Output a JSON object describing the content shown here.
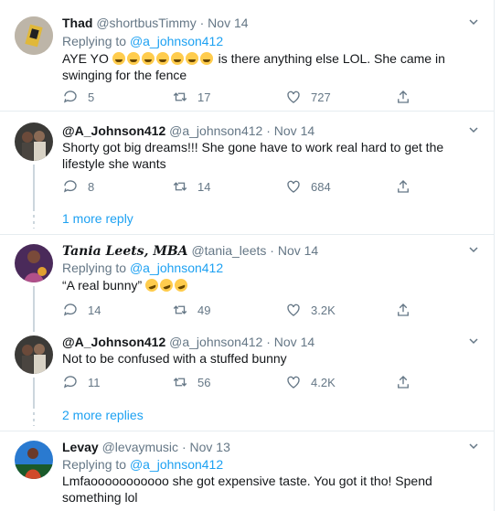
{
  "tweets": [
    {
      "name": "Thad",
      "handle": "@shortbusTimmy",
      "date": "Nov 14",
      "replying_label": "Replying to",
      "replying_to": "@a_johnson412",
      "text_before": "AYE YO",
      "emoji_count": 7,
      "text_after": "is there anything else LOL. She came in swinging for the fence",
      "replies": "5",
      "retweets": "17",
      "likes": "727"
    },
    {
      "name": "@A_Johnson412",
      "handle": "@a_johnson412",
      "date": "Nov 14",
      "text": "Shorty got big dreams!!! She gone have to work real hard to get the lifestyle she wants",
      "replies": "8",
      "retweets": "14",
      "likes": "684"
    },
    {
      "name": "Tania Leets, MBA",
      "handle": "@tania_leets",
      "date": "Nov 14",
      "replying_label": "Replying to",
      "replying_to": "@a_johnson412",
      "text": "“A real bunny”",
      "emoji_count": 3,
      "replies": "14",
      "retweets": "49",
      "likes": "3.2K"
    },
    {
      "name": "@A_Johnson412",
      "handle": "@a_johnson412",
      "date": "Nov 14",
      "text": "Not to be confused with a stuffed bunny",
      "replies": "11",
      "retweets": "56",
      "likes": "4.2K"
    },
    {
      "name": "Levay",
      "handle": "@levaymusic",
      "date": "Nov 13",
      "replying_label": "Replying to",
      "replying_to": "@a_johnson412",
      "text": "Lmfaooooooooooo she got expensive taste. You got it tho! Spend something lol"
    }
  ],
  "more_replies_1": "1 more reply",
  "more_replies_2": "2 more replies",
  "separator": "·",
  "colors": {
    "accent": "#1da1f2",
    "muted": "#657786",
    "emoji": "#ffcc4d"
  }
}
